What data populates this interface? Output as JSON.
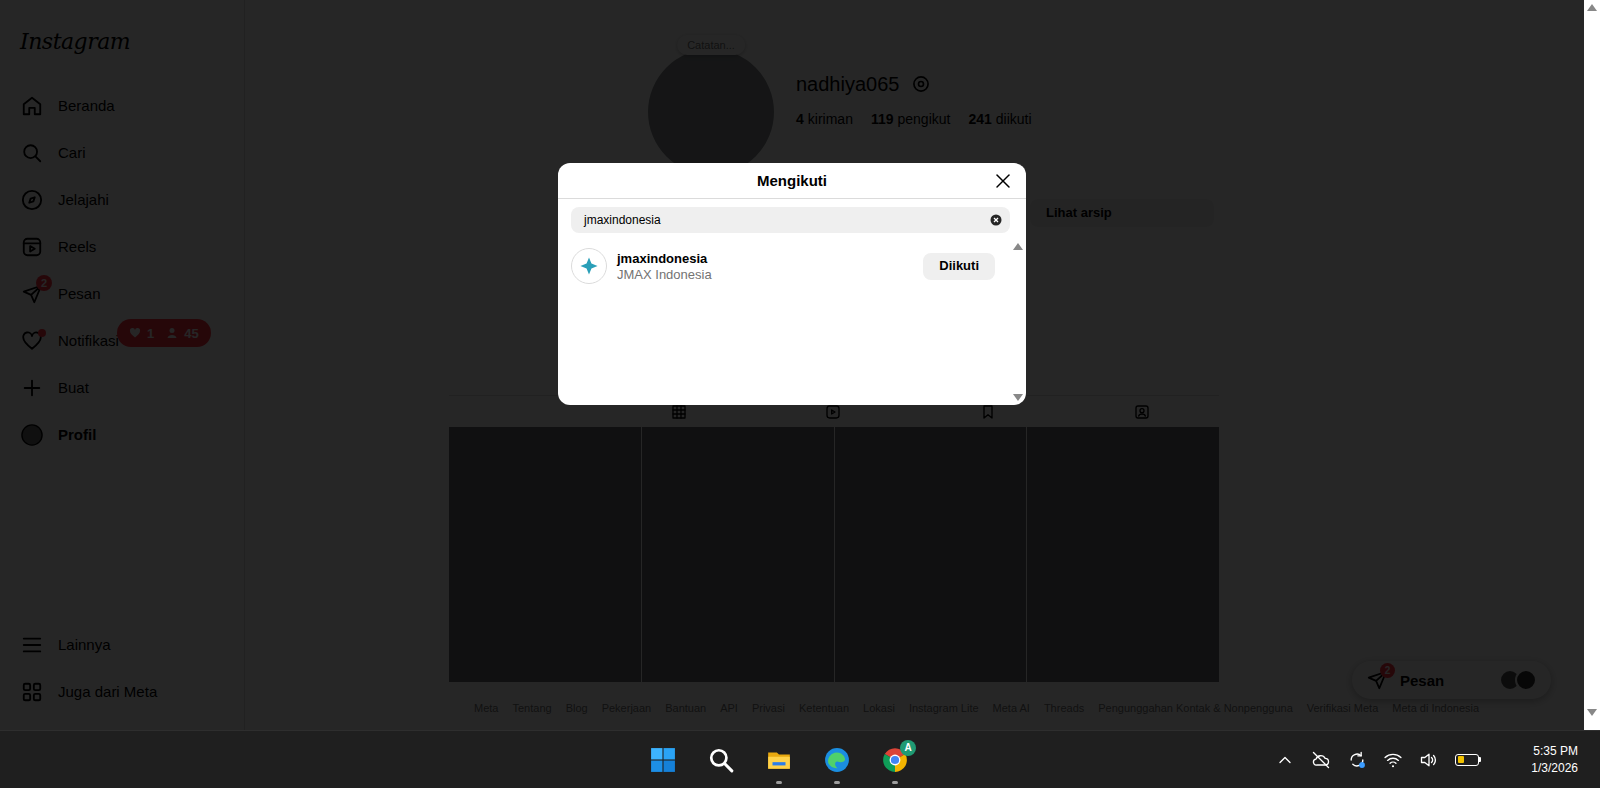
{
  "sidebar": {
    "logo": "Instagram",
    "items": [
      {
        "label": "Beranda",
        "kind": "home",
        "selected": false,
        "dot": false
      },
      {
        "label": "Cari",
        "kind": "search",
        "selected": false,
        "dot": false
      },
      {
        "label": "Jelajahi",
        "kind": "explore",
        "selected": false,
        "dot": false
      },
      {
        "label": "Reels",
        "kind": "reels",
        "selected": false,
        "dot": false
      },
      {
        "label": "Pesan",
        "kind": "messages",
        "selected": false,
        "dot": false,
        "badge": "2"
      },
      {
        "label": "Notifikasi",
        "kind": "notifications",
        "selected": false,
        "dot": true
      },
      {
        "label": "Buat",
        "kind": "create",
        "selected": false,
        "dot": false
      },
      {
        "label": "Profil",
        "kind": "profile",
        "selected": true,
        "dot": false
      }
    ],
    "bottom_items": [
      {
        "label": "Lainnya",
        "kind": "more"
      },
      {
        "label": "Juga dari Meta",
        "kind": "meta"
      }
    ]
  },
  "notification_popup": {
    "likes": "1",
    "followers": "45"
  },
  "profile": {
    "note": "Catatan...",
    "username": "nadhiya065",
    "stats": [
      {
        "value": "4",
        "label": "kiriman"
      },
      {
        "value": "119",
        "label": "pengikut"
      },
      {
        "value": "241",
        "label": "diikuti"
      }
    ],
    "buttons": [
      "Lihat arsip"
    ],
    "tabs": [
      {
        "kind": "posts",
        "selected": true
      },
      {
        "kind": "reels",
        "selected": false
      },
      {
        "kind": "saved",
        "selected": false
      },
      {
        "kind": "tagged",
        "selected": false
      }
    ],
    "posts": [
      {
        "kind": "photo"
      },
      {
        "kind": "photo"
      },
      {
        "kind": "photo"
      },
      {
        "kind": "photo"
      }
    ]
  },
  "footer_links": [
    "Meta",
    "Tentang",
    "Blog",
    "Pekerjaan",
    "Bantuan",
    "API",
    "Privasi",
    "Ketentuan",
    "Lokasi",
    "Instagram Lite",
    "Meta AI",
    "Threads",
    "Pengunggahan Kontak & Nonpengguna",
    "Verifikasi Meta",
    "Meta di Indonesia"
  ],
  "messages_button": {
    "label": "Pesan",
    "badge": "2"
  },
  "modal": {
    "title": "Mengikuti",
    "search": {
      "value": "jmaxindonesia"
    },
    "results": [
      {
        "username": "jmaxindonesia",
        "full_name": "JMAX Indonesia",
        "button": "Diikuti"
      }
    ]
  },
  "taskbar": {
    "apps": [
      {
        "kind": "start",
        "running": false
      },
      {
        "kind": "search",
        "running": false
      },
      {
        "kind": "explorer",
        "running": true
      },
      {
        "kind": "edge",
        "running": true
      },
      {
        "kind": "chrome",
        "running": true,
        "badge": "A"
      }
    ],
    "tray": [
      {
        "kind": "chevron"
      },
      {
        "kind": "cloud-off"
      },
      {
        "kind": "sync"
      },
      {
        "kind": "wifi"
      },
      {
        "kind": "volume"
      },
      {
        "kind": "battery",
        "level": 0.35
      }
    ],
    "time": "5:35 PM",
    "date": "1/3/2026"
  }
}
